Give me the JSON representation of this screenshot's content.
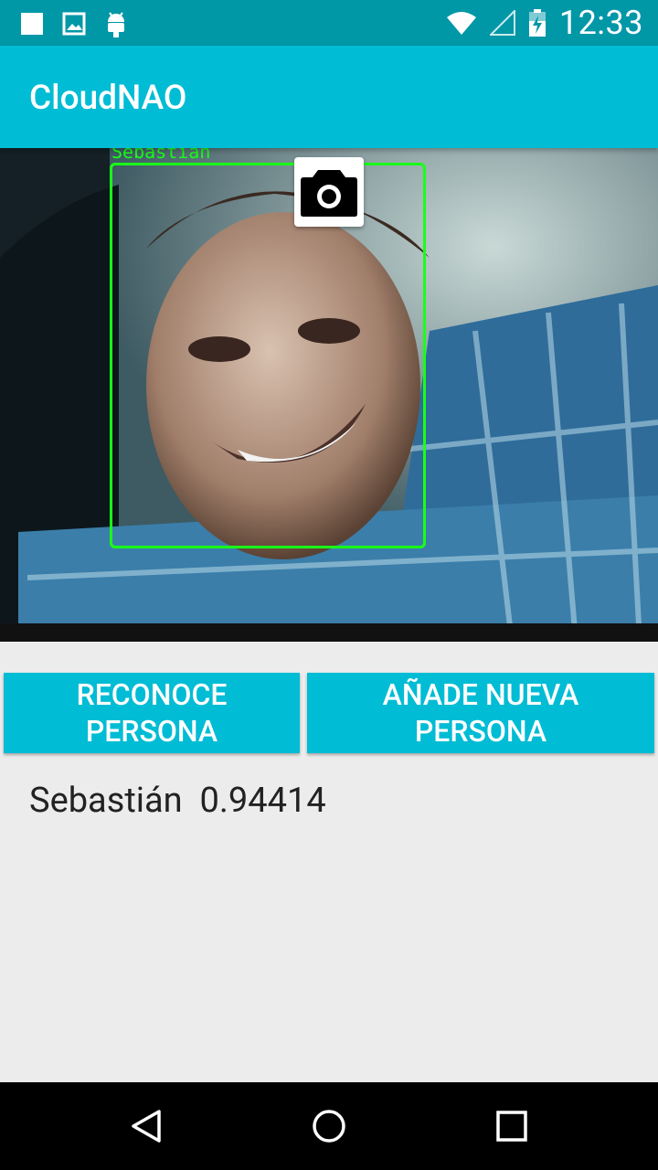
{
  "status_bar": {
    "time": "12:33",
    "left_icons": [
      "square-notification-icon",
      "image-notification-icon",
      "android-icon"
    ],
    "right_icons": [
      "wifi-icon",
      "signal-icon",
      "battery-charging-icon"
    ]
  },
  "app_bar": {
    "title": "CloudNAO"
  },
  "camera_view": {
    "detected_name_label": "Sebastian",
    "face_box_color": "#19ff19",
    "capture_icon": "camera-icon"
  },
  "buttons": {
    "recognize": {
      "line1": "RECONOCE",
      "line2": "PERSONA"
    },
    "add": {
      "line1": "AÑADE NUEVA",
      "line2": "PERSONA"
    }
  },
  "result": {
    "name": "Sebastián",
    "score": "0.94414"
  },
  "nav_bar": {
    "icons": [
      "back-icon",
      "home-icon",
      "recents-icon"
    ]
  },
  "colors": {
    "primary": "#00bcd4",
    "primary_dark": "#0097a7",
    "background": "#ececec"
  }
}
